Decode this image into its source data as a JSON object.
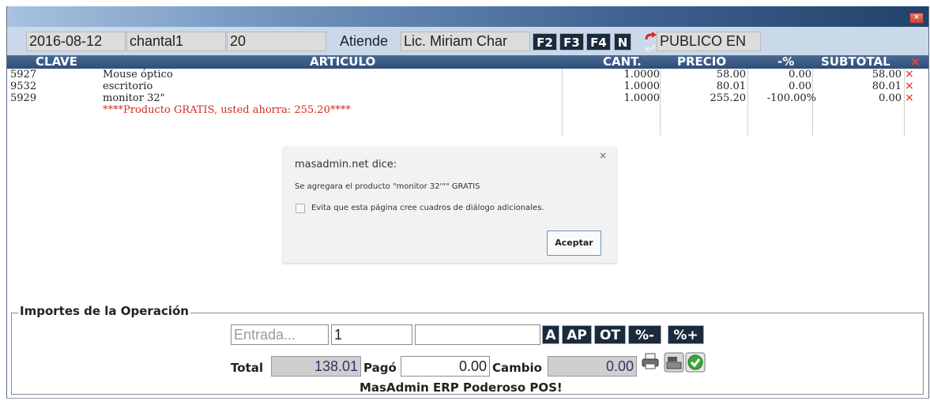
{
  "window": {
    "close_label": "×"
  },
  "infobar": {
    "date": "2016-08-12",
    "user": "chantal1",
    "terminal": "20",
    "attends_label": "Atiende",
    "attendant": "Lic. Miriam Char",
    "keys": [
      "F2",
      "F3",
      "F4",
      "N"
    ],
    "client": "PUBLICO EN"
  },
  "columns": {
    "clave": "CLAVE",
    "articulo": "ARTICULO",
    "cant": "CANT.",
    "precio": "PRECIO",
    "descuento": "-%",
    "subtotal": "SUBTOTAL",
    "delete": "×"
  },
  "rows": [
    {
      "clave": "5927",
      "articulo": "Mouse óptico",
      "cant": "1.0000",
      "precio": "58.00",
      "descuento": "0.00",
      "subtotal": "58.00",
      "delete": "×"
    },
    {
      "clave": "9532",
      "articulo": "escritorio",
      "cant": "1.0000",
      "precio": "80.01",
      "descuento": "0.00",
      "subtotal": "80.01",
      "delete": "×"
    },
    {
      "clave": "5929",
      "articulo": "monitor 32\"",
      "cant": "1.0000",
      "precio": "255.20",
      "descuento": "-100.00%",
      "subtotal": "0.00",
      "delete": "×"
    }
  ],
  "promo_note": "****Producto GRATIS, usted ahorra: 255.20****",
  "dialog": {
    "close": "×",
    "title": "masadmin.net dice:",
    "message": "Se agregara el producto \"monitor 32'\"\" GRATIS",
    "checkbox_label": "Evita que esta página cree cuadros de diálogo adicionales.",
    "ok_button": "Aceptar"
  },
  "importes": {
    "legend": "Importes de la Operación",
    "entrada_placeholder": "Entrada...",
    "cantidad": "1",
    "extra": "",
    "buttons": [
      "A",
      "AP",
      "OT",
      "%-",
      "%+"
    ],
    "total_label": "Total",
    "total": "138.01",
    "pago_label": "Pagó",
    "pago": "0.00",
    "cambio_label": "Cambio",
    "cambio": "0.00",
    "footer": "MasAdmin ERP Poderoso POS!"
  },
  "icons": {
    "swap": "swap-arrows-icon",
    "print": "printer-icon",
    "register": "cash-register-icon",
    "confirm": "check-circle-icon"
  },
  "colors": {
    "header": "#2f4e78",
    "infobar": "#c9d9ea",
    "accent_red": "#d62a1e",
    "key_bg": "#1b2a3c"
  }
}
